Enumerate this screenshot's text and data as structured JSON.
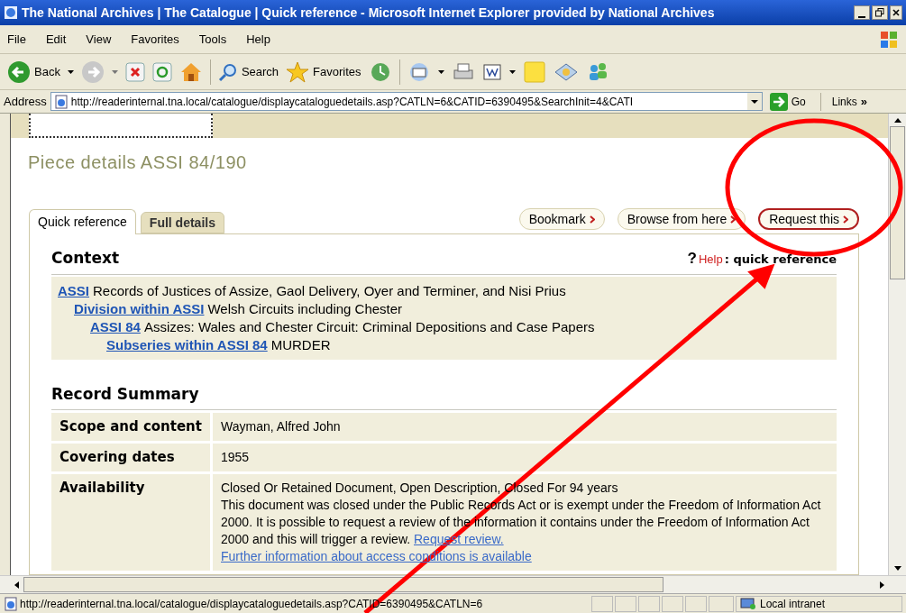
{
  "window": {
    "title": "The National Archives | The Catalogue | Quick reference - Microsoft Internet Explorer provided by National Archives"
  },
  "menu": [
    "File",
    "Edit",
    "View",
    "Favorites",
    "Tools",
    "Help"
  ],
  "toolbar": {
    "back": "Back",
    "search": "Search",
    "favorites": "Favorites"
  },
  "address": {
    "label": "Address",
    "url": "http://readerinternal.tna.local/catalogue/displaycataloguedetails.asp?CATLN=6&CATID=6390495&SearchInit=4&CATI",
    "go": "Go",
    "links": "Links",
    "more": "»"
  },
  "page": {
    "heading": "Piece details ASSI 84/190",
    "tabs": [
      {
        "label": "Quick reference",
        "selected": true
      },
      {
        "label": "Full details",
        "selected": false
      }
    ],
    "actions": [
      {
        "label": "Bookmark",
        "highlighted": false
      },
      {
        "label": "Browse from here",
        "highlighted": false
      },
      {
        "label": "Request this",
        "highlighted": true
      }
    ],
    "context": {
      "heading": "Context",
      "help_mark": "?",
      "help": "Help",
      "help_suffix": ": quick reference",
      "tree": [
        {
          "link": "ASSI",
          "text": "Records of Justices of Assize, Gaol Delivery, Oyer and Terminer, and Nisi Prius",
          "children": [
            {
              "link": "Division within ASSI",
              "text": "Welsh Circuits including Chester",
              "children": [
                {
                  "link": "ASSI 84",
                  "text": "Assizes: Wales and Chester Circuit: Criminal Depositions and Case Papers",
                  "children": [
                    {
                      "link": "Subseries within ASSI 84",
                      "text": "MURDER"
                    }
                  ]
                }
              ]
            }
          ]
        }
      ]
    },
    "summary": {
      "heading": "Record Summary",
      "rows": [
        {
          "label": "Scope and content",
          "lines": [
            "Wayman, Alfred John"
          ]
        },
        {
          "label": "Covering dates",
          "lines": [
            "1955"
          ]
        },
        {
          "label": "Availability",
          "lines": [
            "Closed Or Retained Document, Open Description, Closed For 94 years",
            "This document was closed under the Public Records Act or is exempt under the Freedom of Information Act 2000. It is possible to request a review of the information it contains under the Freedom of Information Act 2000 and this will trigger a review."
          ],
          "link": "Request review.",
          "footer_link": "Further information about access conditions is available"
        }
      ]
    }
  },
  "status_bar": {
    "url": "http://readerinternal.tna.local/catalogue/displaycataloguedetails.asp?CATID=6390495&CATLN=6",
    "zone": "Local intranet"
  }
}
